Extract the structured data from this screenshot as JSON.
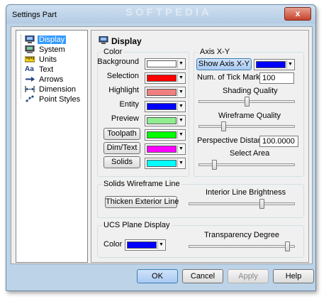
{
  "window": {
    "title": "Settings Part",
    "close_glyph": "x",
    "watermark": "SOFTPEDIA"
  },
  "tree": {
    "items": [
      {
        "label": "Display",
        "icon": "display-icon"
      },
      {
        "label": "System",
        "icon": "system-icon"
      },
      {
        "label": "Units",
        "icon": "units-icon"
      },
      {
        "label": "Text",
        "icon": "text-icon"
      },
      {
        "label": "Arrows",
        "icon": "arrows-icon"
      },
      {
        "label": "Dimension",
        "icon": "dimension-icon"
      },
      {
        "label": "Point Styles",
        "icon": "point-styles-icon"
      }
    ],
    "text_icon_glyph": "Aa"
  },
  "panel": {
    "title": "Display",
    "color_group": {
      "label": "Color",
      "rows": [
        {
          "label": "Background",
          "color": "#ffffff",
          "is_button": false
        },
        {
          "label": "Selection",
          "color": "#ff0000",
          "is_button": false
        },
        {
          "label": "Highlight",
          "color": "#f08080",
          "is_button": false
        },
        {
          "label": "Entity",
          "color": "#0000ff",
          "is_button": false
        },
        {
          "label": "Preview",
          "color": "#90ee90",
          "is_button": false
        },
        {
          "label": "Toolpath",
          "color": "#00ff00",
          "is_button": true
        },
        {
          "label": "Dim/Text",
          "color": "#ff00ff",
          "is_button": true
        },
        {
          "label": "Solids",
          "color": "#00ffff",
          "is_button": true
        }
      ]
    },
    "axis_group": {
      "label": "Axis X-Y",
      "show_axis_label": "Show Axis X-Y",
      "axis_color": "#0000ff",
      "tick_marks_label": "Num. of Tick Marks:",
      "tick_marks_value": "100",
      "shading_label": "Shading Quality",
      "shading_level": 0.5,
      "wireframe_label": "Wireframe Quality",
      "wireframe_level": 0.25,
      "perspective_label": "Perspective Distance:",
      "perspective_value": "100.0000",
      "select_area_label": "Select Area",
      "select_area_level": 0.15
    },
    "solids_group": {
      "label": "Solids Wireframe Line",
      "thicken_label": "Thicken Exterior Line",
      "brightness_label": "Interior Line Brightness",
      "brightness_level": 0.7
    },
    "ucs_group": {
      "label": "UCS Plane Display",
      "color_label": "Color",
      "color": "#0000ff",
      "transparency_label": "Transparency Degree",
      "transparency_level": 0.95
    }
  },
  "buttons": {
    "ok": "OK",
    "cancel": "Cancel",
    "apply": "Apply",
    "help": "Help"
  }
}
